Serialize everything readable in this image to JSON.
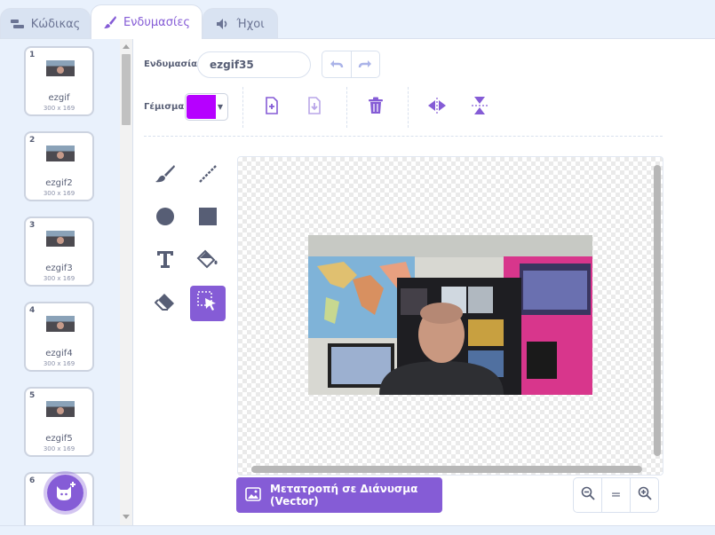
{
  "tabs": [
    {
      "label": "Κώδικας",
      "icon": "code-blocks-icon",
      "active": false
    },
    {
      "label": "Ενδυμασίες",
      "icon": "paintbrush-icon",
      "active": true
    },
    {
      "label": "Ήχοι",
      "icon": "speaker-icon",
      "active": false
    }
  ],
  "costumes": [
    {
      "number": "1",
      "name": "ezgif",
      "size": "300 x 169"
    },
    {
      "number": "2",
      "name": "ezgif2",
      "size": "300 x 169"
    },
    {
      "number": "3",
      "name": "ezgif3",
      "size": "300 x 169"
    },
    {
      "number": "4",
      "name": "ezgif4",
      "size": "300 x 169"
    },
    {
      "number": "5",
      "name": "ezgif5",
      "size": "300 x 169"
    },
    {
      "number": "6"
    }
  ],
  "editor": {
    "costume_label": "Ενδυμασία",
    "costume_name": "ezgif35",
    "fill_label": "Γέμισμα",
    "fill_color": "#b600ff",
    "accent_color": "#855cd6"
  },
  "tools": [
    "brush-icon",
    "line-icon",
    "circle-icon",
    "rectangle-icon",
    "text-icon",
    "fill-icon",
    "eraser-icon",
    "select-icon"
  ],
  "active_tool": "select-icon",
  "convert_button": "Μετατροπή σε Διάνυσμα (Vector)",
  "zoom": {
    "out": "zoom-out-icon",
    "reset": "=",
    "in": "zoom-in-icon"
  }
}
